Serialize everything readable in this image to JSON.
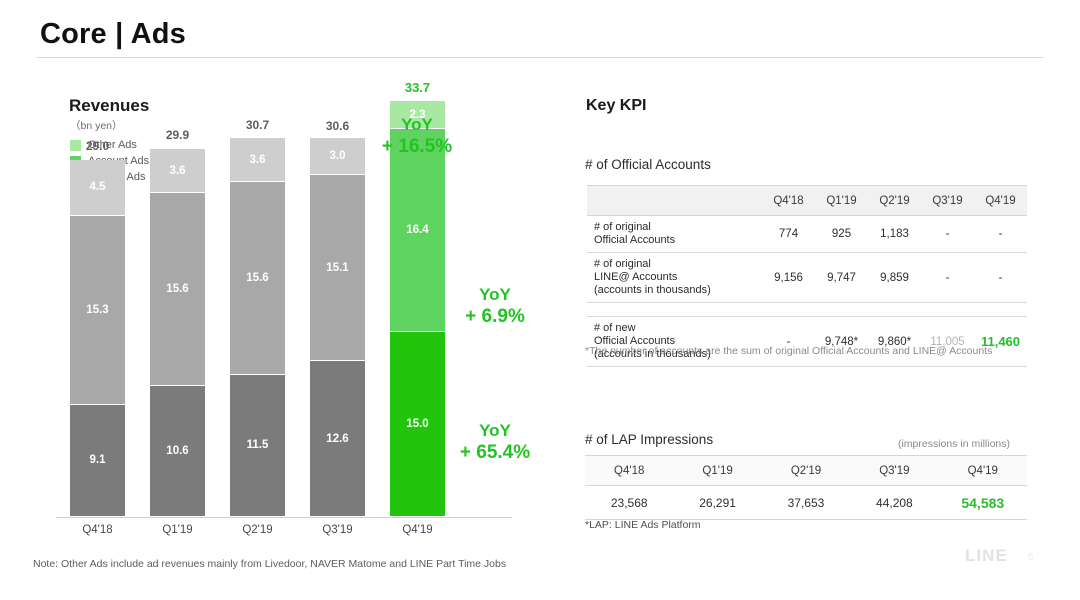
{
  "header": {
    "title": "Core | Ads"
  },
  "left": {
    "revenues_title": "Revenues",
    "unit": "（bn yen）",
    "legend": [
      {
        "label": "Other Ads",
        "color": "#a9e8a3"
      },
      {
        "label": "Account Ads",
        "color": "#5fd35f"
      },
      {
        "label": "Display Ads",
        "color": "#22c40e"
      }
    ],
    "note": "Note: Other Ads include ad revenues mainly from Livedoor, NAVER Matome and LINE Part Time Jobs",
    "yoy_total": {
      "line1": "YoY",
      "line2": "+ 16.5%"
    },
    "yoy_account": {
      "line1": "YoY",
      "line2": "+ 6.9%"
    },
    "yoy_display": {
      "line1": "YoY",
      "line2": "+ 65.4%"
    }
  },
  "chart_data": {
    "type": "bar",
    "title": "Revenues",
    "ylabel": "bn yen",
    "xlabel": "",
    "stacked": true,
    "grid": false,
    "legend_position": "top-left",
    "categories": [
      "Q4'18",
      "Q1'19",
      "Q2'19",
      "Q3'19",
      "Q4'19"
    ],
    "series": [
      {
        "name": "Display Ads",
        "color": "#22c40e",
        "gray": "#7b7b7b",
        "values": [
          9.1,
          10.6,
          11.5,
          12.6,
          15.0
        ]
      },
      {
        "name": "Account Ads",
        "color": "#5fd35f",
        "gray": "#a8a8a8",
        "values": [
          15.3,
          15.6,
          15.6,
          15.1,
          16.4
        ]
      },
      {
        "name": "Other Ads",
        "color": "#a9e8a3",
        "gray": "#cecece",
        "values": [
          4.5,
          3.6,
          3.6,
          3.0,
          2.3
        ]
      }
    ],
    "totals": [
      29.0,
      29.9,
      30.7,
      30.6,
      33.7
    ],
    "highlight_index": 4,
    "ylim": [
      0,
      36
    ]
  },
  "right": {
    "kpi_title": "Key KPI",
    "official_accounts": {
      "section_title": "# of Official Accounts",
      "columns": [
        "",
        "Q4'18",
        "Q1'19",
        "Q2'19",
        "Q3'19",
        "Q4'19"
      ],
      "rows": [
        {
          "label": "# of original\nOfficial Accounts",
          "values": [
            "774",
            "925",
            "1,183",
            "-",
            "-"
          ],
          "styles": [
            "",
            "",
            "",
            "",
            ""
          ]
        },
        {
          "label": "# of original\nLINE@ Accounts\n(accounts in thousands)",
          "values": [
            "9,156",
            "9,747",
            "9,859",
            "-",
            "-"
          ],
          "styles": [
            "",
            "",
            "",
            "",
            ""
          ]
        },
        {
          "label": "# of new\nOfficial Accounts\n(accounts in thousands)",
          "values": [
            "-",
            "9,748*",
            "9,860*",
            "11,005",
            "11,460"
          ],
          "styles": [
            "",
            "",
            "",
            "muted",
            "hl"
          ]
        }
      ],
      "footnote": "*The number of accounts are the sum of original Official Accounts and LINE@ Accounts"
    },
    "lap": {
      "section_title": "# of LAP Impressions",
      "unit": "(impressions in millions)",
      "columns": [
        "Q4'18",
        "Q1'19",
        "Q2'19",
        "Q3'19",
        "Q4'19"
      ],
      "values": [
        "23,568",
        "26,291",
        "37,653",
        "44,208",
        "54,583"
      ],
      "styles": [
        "",
        "",
        "",
        "",
        "hl"
      ],
      "footnote": "*LAP: LINE Ads Platform"
    }
  },
  "footer": {
    "logo": "LINE",
    "page": "6"
  },
  "colors": {
    "accent_green": "#22c323",
    "bright_green": "#22c40e",
    "mid_green": "#5fd35f",
    "light_green": "#a9e8a3",
    "gray_dark": "#7b7b7b",
    "gray_mid": "#a8a8a8",
    "gray_light": "#cecece"
  }
}
